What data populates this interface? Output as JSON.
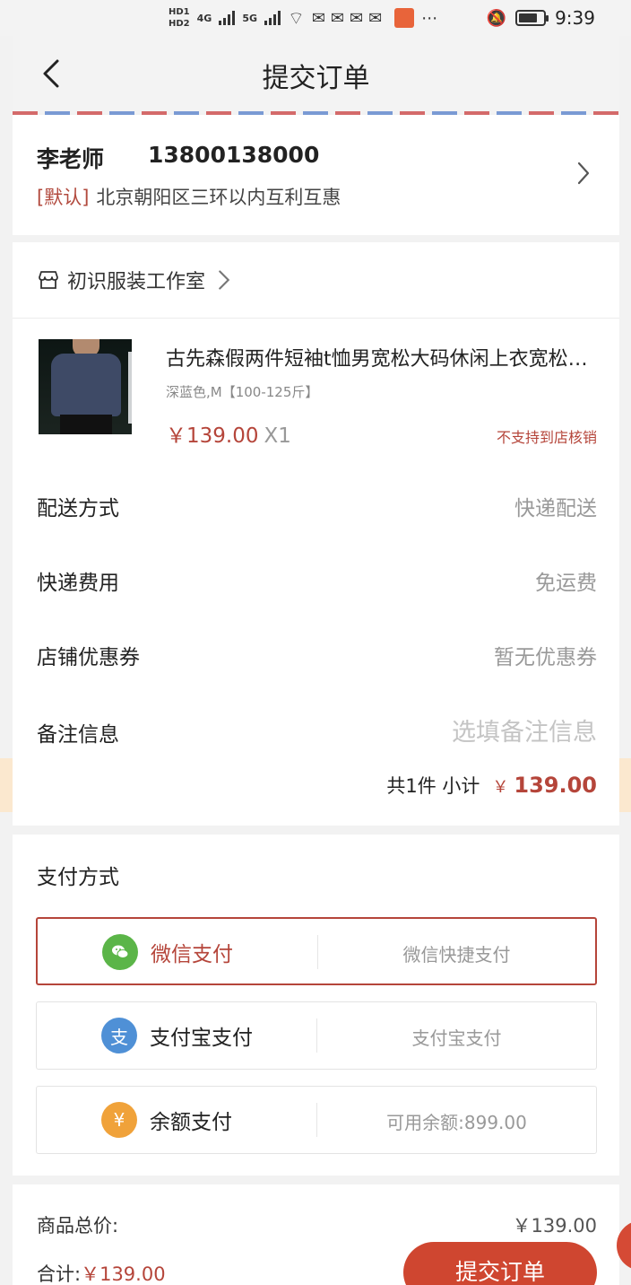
{
  "status_bar": {
    "hd1": "HD1",
    "hd2": "HD2",
    "net1": "4G",
    "net2": "5G",
    "time": "9:39"
  },
  "nav": {
    "title": "提交订单"
  },
  "address": {
    "name": "李老师",
    "phone": "13800138000",
    "tag": "[默认]",
    "detail": "北京朝阳区三环以内互利互惠"
  },
  "shop": {
    "name": "初识服装工作室"
  },
  "product": {
    "title": "古先森假两件短袖t恤男宽松大码休闲上衣宽松大码",
    "spec": "深蓝色,M【100-125斤】",
    "price": "￥139.00",
    "qty": "X1",
    "note": "不支持到店核销"
  },
  "rows": {
    "delivery_label": "配送方式",
    "delivery_value": "快递配送",
    "fee_label": "快递费用",
    "fee_value": "免运费",
    "coupon_label": "店铺优惠券",
    "coupon_value": "暂无优惠券",
    "remark_label": "备注信息",
    "remark_placeholder": "选填备注信息"
  },
  "subtotal": {
    "text": "共1件 小计",
    "currency": "￥",
    "amount": "139.00"
  },
  "payment": {
    "title": "支付方式",
    "options": [
      {
        "name": "微信支付",
        "desc": "微信快捷支付",
        "icon": "wechat-icon",
        "color": "#5bb548",
        "glyph": "💬"
      },
      {
        "name": "支付宝支付",
        "desc": "支付宝支付",
        "icon": "alipay-icon",
        "color": "#4f90d6",
        "glyph": "支"
      },
      {
        "name": "余额支付",
        "desc": "可用余额:899.00",
        "icon": "balance-icon",
        "color": "#f0a23a",
        "glyph": "¥"
      }
    ]
  },
  "summary": {
    "goods_total_label": "商品总价:",
    "goods_total_value": "￥139.00",
    "total_label": "合计:",
    "total_value": "￥139.00",
    "submit_label": "提交订单"
  },
  "colors": {
    "accent": "#b5453a",
    "button": "#cf4630"
  }
}
